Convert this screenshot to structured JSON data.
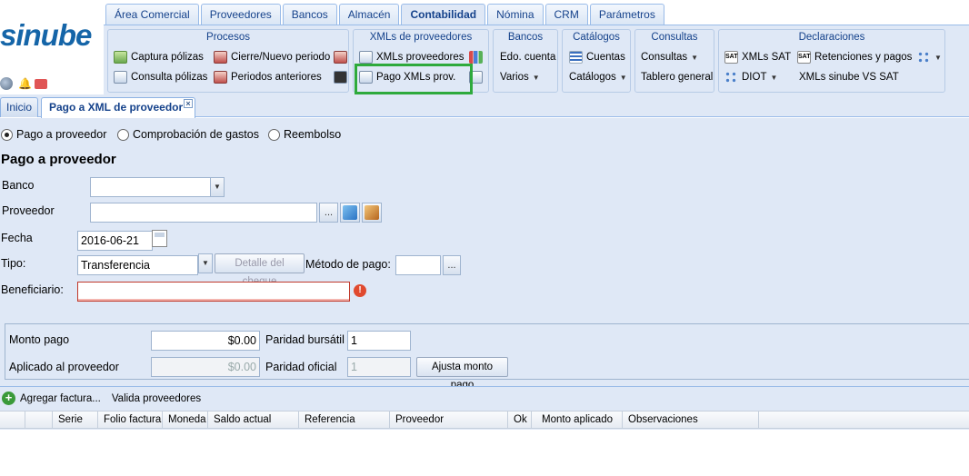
{
  "brand": {
    "logo": "sinube"
  },
  "nav_tabs": [
    "Área Comercial",
    "Proveedores",
    "Bancos",
    "Almacén",
    "Contabilidad",
    "Nómina",
    "CRM",
    "Parámetros"
  ],
  "ribbon": {
    "procesos": {
      "title": "Procesos",
      "captura": "Captura pólizas",
      "consulta": "Consulta pólizas",
      "cierre": "Cierre/Nuevo periodo",
      "periodos": "Periodos anteriores"
    },
    "xmls": {
      "title": "XMLs de proveedores",
      "xmls_prov": "XMLs proveedores",
      "pago": "Pago XMLs prov."
    },
    "bancos": {
      "title": "Bancos",
      "edo": "Edo. cuenta",
      "varios": "Varios"
    },
    "catalogos": {
      "title": "Catálogos",
      "cuentas": "Cuentas",
      "catalogos": "Catálogos"
    },
    "consultas": {
      "title": "Consultas",
      "consultas": "Consultas",
      "tablero": "Tablero general"
    },
    "declaraciones": {
      "title": "Declaraciones",
      "xmls_sat": "XMLs SAT",
      "retenciones": "Retenciones y pagos",
      "diot": "DIOT",
      "vs_sat": "XMLs sinube VS SAT"
    }
  },
  "panel_tabs": {
    "inicio": "Inicio",
    "pago": "Pago a XML de proveedor"
  },
  "radios": {
    "pago": "Pago a proveedor",
    "comprobacion": "Comprobación de gastos",
    "reembolso": "Reembolso"
  },
  "form": {
    "title": "Pago a proveedor",
    "banco_label": "Banco",
    "banco_value": "",
    "proveedor_label": "Proveedor",
    "proveedor_value": "",
    "ellipsis": "...",
    "fecha_label": "Fecha",
    "fecha_value": "2016-06-21",
    "tipo_label": "Tipo:",
    "tipo_value": "Transferencia",
    "detalle_btn": "Detalle del cheque",
    "metodo_label": "Método de pago:",
    "metodo_value": "",
    "beneficiario_label": "Beneficiario:",
    "beneficiario_value": ""
  },
  "amounts": {
    "monto_label": "Monto pago",
    "monto_value": "$0.00",
    "paridad_bursatil_label": "Paridad bursátil",
    "paridad_bursatil_value": "1",
    "aplicado_label": "Aplicado al proveedor",
    "aplicado_value": "$0.00",
    "paridad_oficial_label": "Paridad oficial",
    "paridad_oficial_value": "1",
    "ajusta_btn": "Ajusta monto pago"
  },
  "toolbar": {
    "agregar": "Agregar factura...",
    "valida": "Valida proveedores"
  },
  "grid_columns": [
    "Serie",
    "Folio factura",
    "Moneda",
    "Saldo actual",
    "Referencia",
    "Proveedor",
    "Ok",
    "Monto aplicado",
    "Observaciones"
  ],
  "colors": {
    "highlight": "#2eaa3c",
    "panel": "#dfe8f6",
    "brand": "#1565a8"
  }
}
